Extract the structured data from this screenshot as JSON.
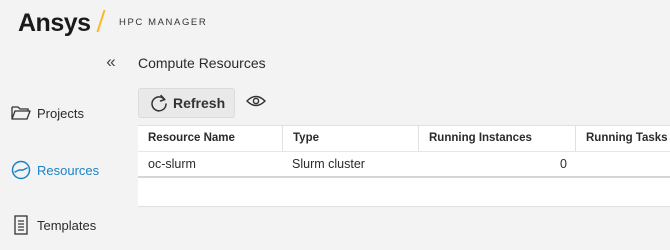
{
  "header": {
    "brand": "Ansys",
    "app_name": "HPC MANAGER"
  },
  "sidebar": {
    "collapse_glyph": "«",
    "items": [
      {
        "label": "Projects",
        "icon": "folder-icon",
        "active": false
      },
      {
        "label": "Resources",
        "icon": "resources-gauge-icon",
        "active": true
      },
      {
        "label": "Templates",
        "icon": "document-list-icon",
        "active": false
      }
    ]
  },
  "main": {
    "title": "Compute Resources",
    "toolbar": {
      "refresh_label": "Refresh",
      "visibility_icon": "eye-icon"
    },
    "table": {
      "columns": [
        "Resource Name",
        "Type",
        "Running Instances",
        "Running Tasks"
      ],
      "rows": [
        {
          "name": "oc-slurm",
          "type": "Slurm cluster",
          "running_instances": "0",
          "running_tasks": ""
        }
      ]
    }
  },
  "colors": {
    "accent": "#1b83c6",
    "brand_slash": "#ffb71b",
    "background": "#f3f3f3"
  }
}
